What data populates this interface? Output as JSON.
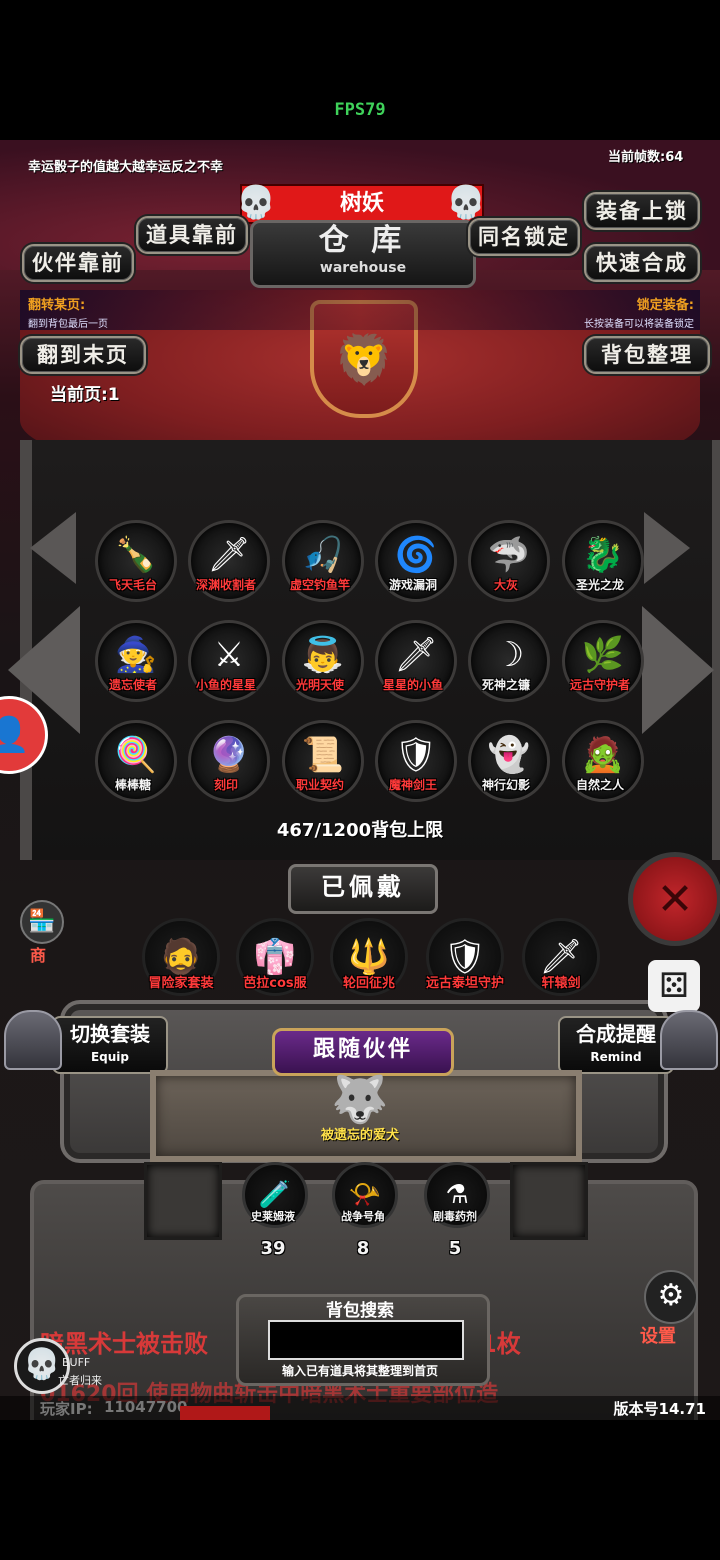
{
  "fps": "FPS79",
  "top": {
    "luck_tip": "幸运骰子的值越大越幸运反之不幸",
    "frame_count": "当前帧数:64"
  },
  "header": {
    "name": "树妖",
    "title_cn": "仓 库",
    "title_en": "warehouse"
  },
  "buttons": {
    "item_front": "道具靠前",
    "partner_front": "伙伴靠前",
    "same_lock": "同名锁定",
    "equip_lock": "装备上锁",
    "quick_merge": "快速合成",
    "goto_last": "翻到末页",
    "bag_sort": "背包整理"
  },
  "hints": {
    "flip_title": "翻转某页:",
    "flip_desc": "翻到背包最后一页",
    "lock_title": "锁定装备:",
    "lock_desc": "长按装备可以将装备锁定"
  },
  "current_page": "当前页:1",
  "grid": [
    {
      "label": "飞天毛台",
      "icon": "🍾",
      "color": "red"
    },
    {
      "label": "深渊收割者",
      "icon": "🗡",
      "color": "red"
    },
    {
      "label": "虚空钓鱼竿",
      "icon": "🎣",
      "color": "red"
    },
    {
      "label": "游戏漏洞",
      "icon": "🌀",
      "color": "white"
    },
    {
      "label": "大灰",
      "icon": "🦈",
      "color": "red"
    },
    {
      "label": "圣光之龙",
      "icon": "🐉",
      "color": "white"
    },
    {
      "label": "遗忘使者",
      "icon": "🧙",
      "color": "red"
    },
    {
      "label": "小鱼的星星",
      "icon": "⚔",
      "color": "red"
    },
    {
      "label": "光明天使",
      "icon": "👼",
      "color": "red"
    },
    {
      "label": "星星的小鱼",
      "icon": "🗡",
      "color": "red"
    },
    {
      "label": "死神之镰",
      "icon": "☽",
      "color": "white"
    },
    {
      "label": "远古守护者",
      "icon": "🌿",
      "color": "red"
    },
    {
      "label": "棒棒糖",
      "icon": "🍭",
      "color": "white"
    },
    {
      "label": "刻印",
      "icon": "🔮",
      "color": "red"
    },
    {
      "label": "职业契约",
      "icon": "📜",
      "color": "red"
    },
    {
      "label": "魔神剑王",
      "icon": "🛡",
      "color": "red"
    },
    {
      "label": "神行幻影",
      "icon": "👻",
      "color": "white"
    },
    {
      "label": "自然之人",
      "icon": "🧟",
      "color": "white"
    }
  ],
  "capacity": "467/1200背包上限",
  "equipped": {
    "title": "已佩戴",
    "items": [
      {
        "label": "冒险家套装",
        "icon": "🧔",
        "color": "red"
      },
      {
        "label": "芭拉cos服",
        "icon": "👘",
        "color": "red"
      },
      {
        "label": "轮回征兆",
        "icon": "🔱",
        "color": "red"
      },
      {
        "label": "远古泰坦守护",
        "icon": "🛡",
        "color": "red"
      },
      {
        "label": "轩辕剑",
        "icon": "🗡",
        "color": "red"
      }
    ]
  },
  "switch_equip": {
    "cn": "切换套装",
    "en": "Equip"
  },
  "merge_remind": {
    "cn": "合成提醒",
    "en": "Remind"
  },
  "partner": {
    "title": "跟随伙伴",
    "name": "被遗忘的爱犬",
    "icon": "🐺"
  },
  "consumables": [
    {
      "label": "史莱姆液",
      "count": "39",
      "icon": "🧪"
    },
    {
      "label": "战争号角",
      "count": "8",
      "icon": "📯"
    },
    {
      "label": "剧毒药剂",
      "count": "5",
      "icon": "⚗"
    }
  ],
  "search": {
    "title": "背包搜索",
    "hint": "输入已有道具将其整理到首页",
    "value": ""
  },
  "bg_text": {
    "kill_left": "暗黑术士被击败",
    "kill_right": "1枚",
    "scroll_line": "01620回 使用物曲斩击中暗黑术士重要部位造",
    "buff": "BUFF",
    "buff_sub": "亡者归来"
  },
  "footer": {
    "player_ip_label": "玩家IP:",
    "player_ip": "11047700",
    "version": "版本号14.71",
    "settings": "设置",
    "shop": "商"
  }
}
